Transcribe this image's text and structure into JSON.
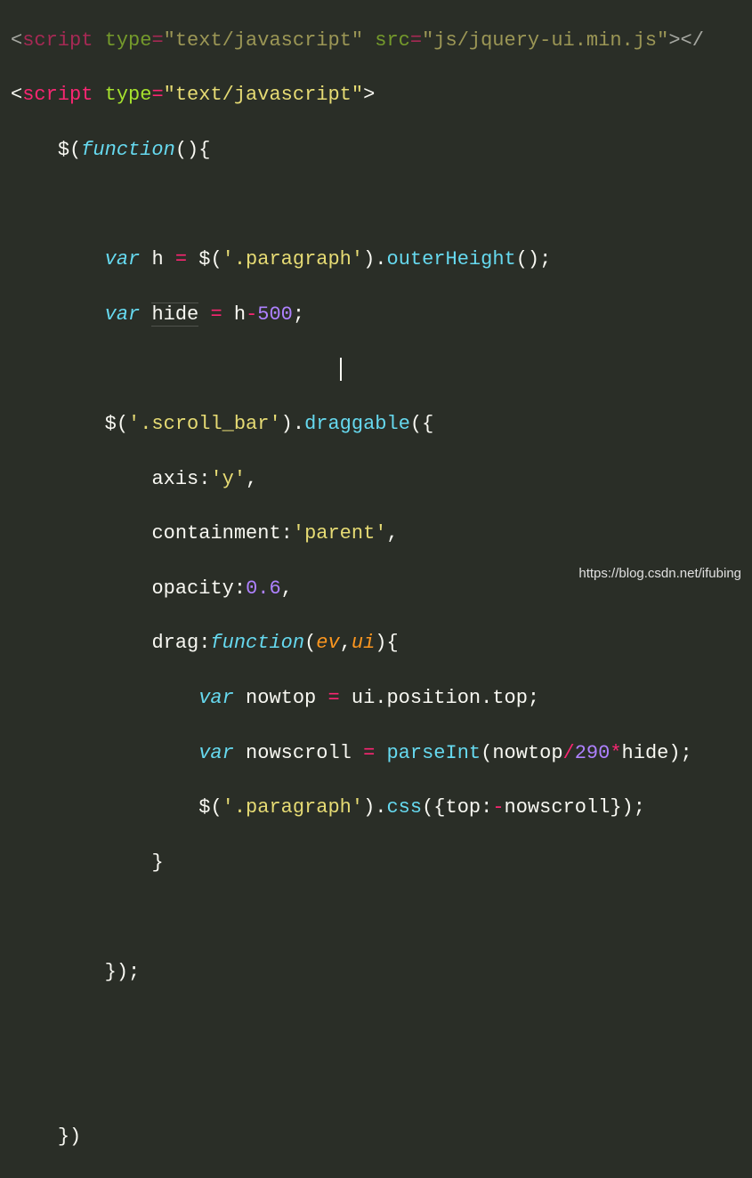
{
  "code": {
    "line0_partial": "<script type=\"text/javascript\" src=\"js/jquery-ui.min.js\"></",
    "tag_open": "script",
    "attr_type": "type",
    "attr_type_val": "\"text/javascript\"",
    "fn_keyword": "function",
    "var_keyword": "var",
    "var_h": "h",
    "var_hide": "hide",
    "var_hide_caret": "hi|de",
    "jquery": "$",
    "sel_paragraph": "'.paragraph'",
    "sel_scroll_bar": "'.scroll_bar'",
    "method_outerHeight": "outerHeight",
    "method_draggable": "draggable",
    "method_css": "css",
    "method_parseInt": "parseInt",
    "prop_axis": "axis",
    "prop_axis_val": "'y'",
    "prop_containment": "containment",
    "prop_containment_val": "'parent'",
    "prop_opacity": "opacity",
    "prop_opacity_val": "0.6",
    "prop_drag": "drag",
    "param_ev": "ev",
    "param_ui": "ui",
    "var_nowtop": "nowtop",
    "var_nowscroll": "nowscroll",
    "expr_ui_position_top": "ui.position.top",
    "num_290": "290",
    "num_500": "500",
    "prop_top": "top",
    "hide_ref": "hide",
    "h_ref": "h",
    "nowtop_ref": "nowtop",
    "nowscroll_ref": "nowscroll"
  },
  "watermark": "https://blog.csdn.net/ifubing"
}
